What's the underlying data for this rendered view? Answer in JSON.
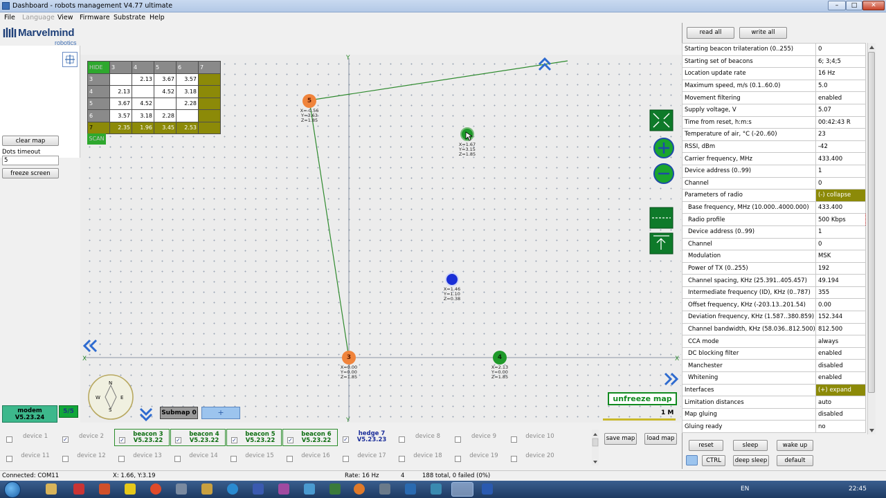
{
  "window": {
    "title": "Dashboard - robots management   V4.77   ultimate",
    "controls": [
      "minimize",
      "maximize",
      "close"
    ]
  },
  "menu": [
    "File",
    "Language",
    "View",
    "Firmware",
    "Substrate",
    "Help"
  ],
  "logo": {
    "brand": "Marvelmind",
    "sub": "robotics"
  },
  "left": {
    "clear_map": "clear map",
    "dots_timeout_label": "Dots timeout",
    "dots_timeout_value": "5",
    "freeze_screen": "freeze screen",
    "modem_title": "modem",
    "modem_version": "V5.23.24",
    "modem_count": "5/5"
  },
  "distance_table": {
    "hide_label": "HIDE",
    "scan_label": "SCAN",
    "columns": [
      "3",
      "4",
      "5",
      "6",
      "7"
    ],
    "rows": [
      {
        "id": "3",
        "cells": [
          "",
          "2.13",
          "3.67",
          "3.57",
          ""
        ]
      },
      {
        "id": "4",
        "cells": [
          "2.13",
          "",
          "4.52",
          "3.18",
          ""
        ]
      },
      {
        "id": "5",
        "cells": [
          "3.67",
          "4.52",
          "",
          "2.28",
          ""
        ]
      },
      {
        "id": "6",
        "cells": [
          "3.57",
          "3.18",
          "2.28",
          "",
          ""
        ]
      },
      {
        "id": "7",
        "cells": [
          "2.35",
          "1.96",
          "3.45",
          "2.53",
          ""
        ]
      }
    ]
  },
  "map": {
    "beacons": [
      {
        "id": "5",
        "x": "X=-0.56",
        "y": "Y=3.63",
        "z": "Z=1.85",
        "color": "#f0843c"
      },
      {
        "id": "3",
        "x": "X=0.00",
        "y": "Y=0.00",
        "z": "Z=1.85",
        "color": "#f0843c"
      },
      {
        "id": "4",
        "x": "X=2.13",
        "y": "Y=0.00",
        "z": "Z=1.85",
        "color": "#1f9a2a"
      },
      {
        "id": "6",
        "x": "X=1.67",
        "y": "Y=3.15",
        "z": "Z=1.85",
        "color": "#1f9a2a"
      }
    ],
    "hedge": {
      "x": "X=1.46",
      "y": "Y=1.10",
      "z": "Z=0.38",
      "color": "#1a2fd6"
    },
    "axis_y": "Y",
    "axis_x": "X",
    "compass": {
      "n": "N",
      "s": "S",
      "e": "E",
      "w": "W"
    },
    "submap_label": "Submap 0",
    "submap_add": "+",
    "unfreeze": "unfreeze map",
    "scale": "1 M"
  },
  "right": {
    "read_all": "read all",
    "write_all": "write all",
    "properties": [
      {
        "name": "Starting beacon trilateration (0..255)",
        "value": "0"
      },
      {
        "name": "Starting set of beacons",
        "value": "6;  3;4;5"
      },
      {
        "name": "Location update rate",
        "value": "16 Hz"
      },
      {
        "name": "Maximum speed, m/s (0.1..60.0)",
        "value": "5.0"
      },
      {
        "name": "Movement filtering",
        "value": "enabled"
      },
      {
        "name": "Supply voltage, V",
        "value": "5.07"
      },
      {
        "name": "Time from reset, h:m:s",
        "value": "00:42:43   R"
      },
      {
        "name": "Temperature of air, °C (-20..60)",
        "value": "23"
      },
      {
        "name": "RSSI, dBm",
        "value": "-42"
      },
      {
        "name": "Carrier frequency, MHz",
        "value": "433.400"
      },
      {
        "name": "Device address (0..99)",
        "value": "1"
      },
      {
        "name": "Channel",
        "value": "0"
      },
      {
        "name": "Parameters of radio",
        "value": "(-) collapse",
        "group": true
      },
      {
        "name": "Base frequency, MHz (10.000..4000.000)",
        "value": "433.400",
        "sub": true
      },
      {
        "name": "Radio profile",
        "value": "500 Kbps",
        "sub": true,
        "focus": true
      },
      {
        "name": "Device address (0..99)",
        "value": "1",
        "sub": true
      },
      {
        "name": "Channel",
        "value": "0",
        "sub": true
      },
      {
        "name": "Modulation",
        "value": "MSK",
        "sub": true
      },
      {
        "name": "Power of TX (0..255)",
        "value": "192",
        "sub": true
      },
      {
        "name": "Channel spacing, KHz (25.391..405.457)",
        "value": "49.194",
        "sub": true
      },
      {
        "name": "Intermediate frequency (ID), KHz (0..787)",
        "value": "355",
        "sub": true
      },
      {
        "name": "Offset frequency, KHz (-203.13..201.54)",
        "value": "0.00",
        "sub": true
      },
      {
        "name": "Deviation frequency, KHz (1.587..380.859)",
        "value": "152.344",
        "sub": true
      },
      {
        "name": "Channel bandwidth, KHz (58.036..812.500)",
        "value": "812.500",
        "sub": true
      },
      {
        "name": "CCA mode",
        "value": "always",
        "sub": true
      },
      {
        "name": "DC blocking filter",
        "value": "enabled",
        "sub": true
      },
      {
        "name": "Manchester",
        "value": "disabled",
        "sub": true
      },
      {
        "name": "Whitening",
        "value": "enabled",
        "sub": true
      },
      {
        "name": "Interfaces",
        "value": "(+) expand",
        "group": true
      },
      {
        "name": "Limitation distances",
        "value": "auto"
      },
      {
        "name": "Map gluing",
        "value": "disabled"
      },
      {
        "name": "Gluing ready",
        "value": "no"
      }
    ],
    "reset": "reset",
    "sleep": "sleep",
    "wake_up": "wake up",
    "ctrl": "CTRL",
    "deep_sleep": "deep sleep",
    "default": "default",
    "save_map": "save map",
    "load_map": "load map"
  },
  "devices": [
    {
      "label": "device 1",
      "checked": false
    },
    {
      "label": "device 2",
      "checked": true
    },
    {
      "label": "beacon 3",
      "version": "V5.23.22",
      "checked": true,
      "active": true
    },
    {
      "label": "beacon 4",
      "version": "V5.23.22",
      "checked": true,
      "active": true
    },
    {
      "label": "beacon 5",
      "version": "V5.23.22",
      "checked": true,
      "active": true
    },
    {
      "label": "beacon 6",
      "version": "V5.23.22",
      "checked": true,
      "active": true
    },
    {
      "label": "hedge 7",
      "version": "V5.23.23",
      "checked": true,
      "hedge": true
    },
    {
      "label": "device 8",
      "checked": false
    },
    {
      "label": "device 9",
      "checked": false
    },
    {
      "label": "device 10",
      "checked": false
    },
    {
      "label": "device 11",
      "checked": false
    },
    {
      "label": "device 12",
      "checked": false
    },
    {
      "label": "device 13",
      "checked": false
    },
    {
      "label": "device 14",
      "checked": false
    },
    {
      "label": "device 15",
      "checked": false
    },
    {
      "label": "device 16",
      "checked": false
    },
    {
      "label": "device 17",
      "checked": false
    },
    {
      "label": "device 18",
      "checked": false
    },
    {
      "label": "device 19",
      "checked": false
    },
    {
      "label": "device 20",
      "checked": false
    }
  ],
  "status": {
    "connected": "Connected: COM11",
    "cursor": "X: 1.66, Y:3.19",
    "rate": "Rate: 16 Hz",
    "count": "4",
    "stats": "188 total, 0 failed (0%)"
  },
  "taskbar": {
    "lang": "EN",
    "time": "22:45"
  },
  "colors": {
    "beacon_orange": "#f0843c",
    "beacon_green": "#1f9a2a",
    "hedge_blue": "#1a2fd6",
    "olive": "#8c8a08",
    "map_line": "#2e8a2e"
  }
}
